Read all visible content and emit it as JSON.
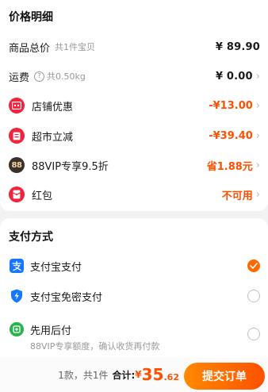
{
  "price_section": {
    "title": "价格明细",
    "goods_total": {
      "label": "商品总价",
      "sub": "共1件宝贝",
      "value": "¥ 89.90"
    },
    "shipping": {
      "label": "运费",
      "sub": "共0.50kg",
      "help_glyph": "?",
      "value": "¥ 0.00"
    },
    "items": [
      {
        "icon": "shop-coupon-icon",
        "label": "店铺优惠",
        "value": "-¥13.00"
      },
      {
        "icon": "supermarket-discount-icon",
        "label": "超市立减",
        "value": "-¥39.40"
      },
      {
        "icon": "vip-88-icon",
        "icon_text": "88",
        "label": "88VIP专享9.5折",
        "value": "省1.88元"
      },
      {
        "icon": "red-packet-icon",
        "label": "红包",
        "value": "不可用"
      }
    ]
  },
  "payment_section": {
    "title": "支付方式",
    "options": [
      {
        "icon": "alipay-icon",
        "label": "支付宝支付",
        "selected": true
      },
      {
        "icon": "shield-icon",
        "label": "支付宝免密支付",
        "selected": false
      },
      {
        "icon": "pay-later-icon",
        "label": "先用后付",
        "desc": "88VIP专享额度，确认收货再付款",
        "selected": false
      }
    ]
  },
  "footer": {
    "count_text": "1款，共1件",
    "total_label": "合计:",
    "currency": "¥",
    "total_int": "35",
    "total_dec": ".62",
    "submit_label": "提交订单"
  },
  "colors": {
    "accent": "#ff5000",
    "coupon_red": "#f2243d",
    "vip_dark": "#3a302c"
  }
}
